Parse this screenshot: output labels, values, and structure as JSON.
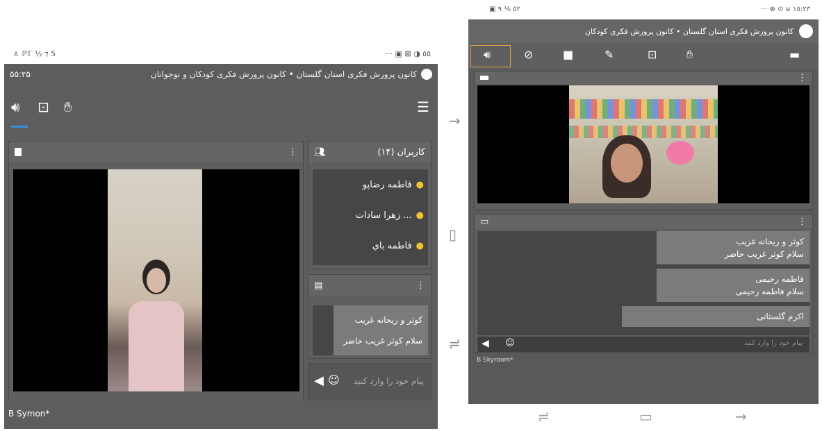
{
  "left": {
    "status_left": "ㅿ ℙℾ ½ ⁊ 5",
    "status_right": "··· ▣ ⊠ ◑ ٥٥",
    "title": "کانون پرورش فکری استان گلستان • کانون پرورش فکری کودکان و نوجوانان",
    "time_label": "۵۵:۲۵",
    "users_title": "کاربران (۱۴)",
    "users": [
      "فاطمه رضاپو",
      "زهرا سادات ...",
      "فاطمه باي",
      "..."
    ],
    "chat_messages": [
      "کوثر و ریحانه غریب",
      "سلام کوثر غریب حاضر"
    ],
    "chat_placeholder": "پیام خود را وارد کنید",
    "footer_text": "B Symon*"
  },
  "middle": {
    "back_icon": "arrow-right-icon",
    "home_icon": "square-icon",
    "recent_icon": "recent-apps-icon"
  },
  "right": {
    "status_left": "▣ ٥٢ ⅙ ٩",
    "status_right": "··· ⊗ ⊙ ⊌ ١٥:٢٣",
    "title": "کانون پرورش فکری استان گلستان • کانون پرورش فکری کودکان",
    "chat_messages": [
      {
        "name": "کوثر و ریحانه غریب",
        "text": "سلام کوثر غریب حاضر"
      },
      {
        "name": "فاطمه رحیمی",
        "text": "سلام فاطمه رحیمی"
      },
      {
        "name": "اکرم گلستانی",
        "text": ""
      }
    ],
    "chat_placeholder": "پیام خود را وارد کنید",
    "footer_text": "B Skyroom*"
  },
  "colors": {
    "panel": "#5d5d5d",
    "accent": "#3b8dde",
    "active_border": "#e0a04a",
    "user_icon": "#f1c232"
  }
}
